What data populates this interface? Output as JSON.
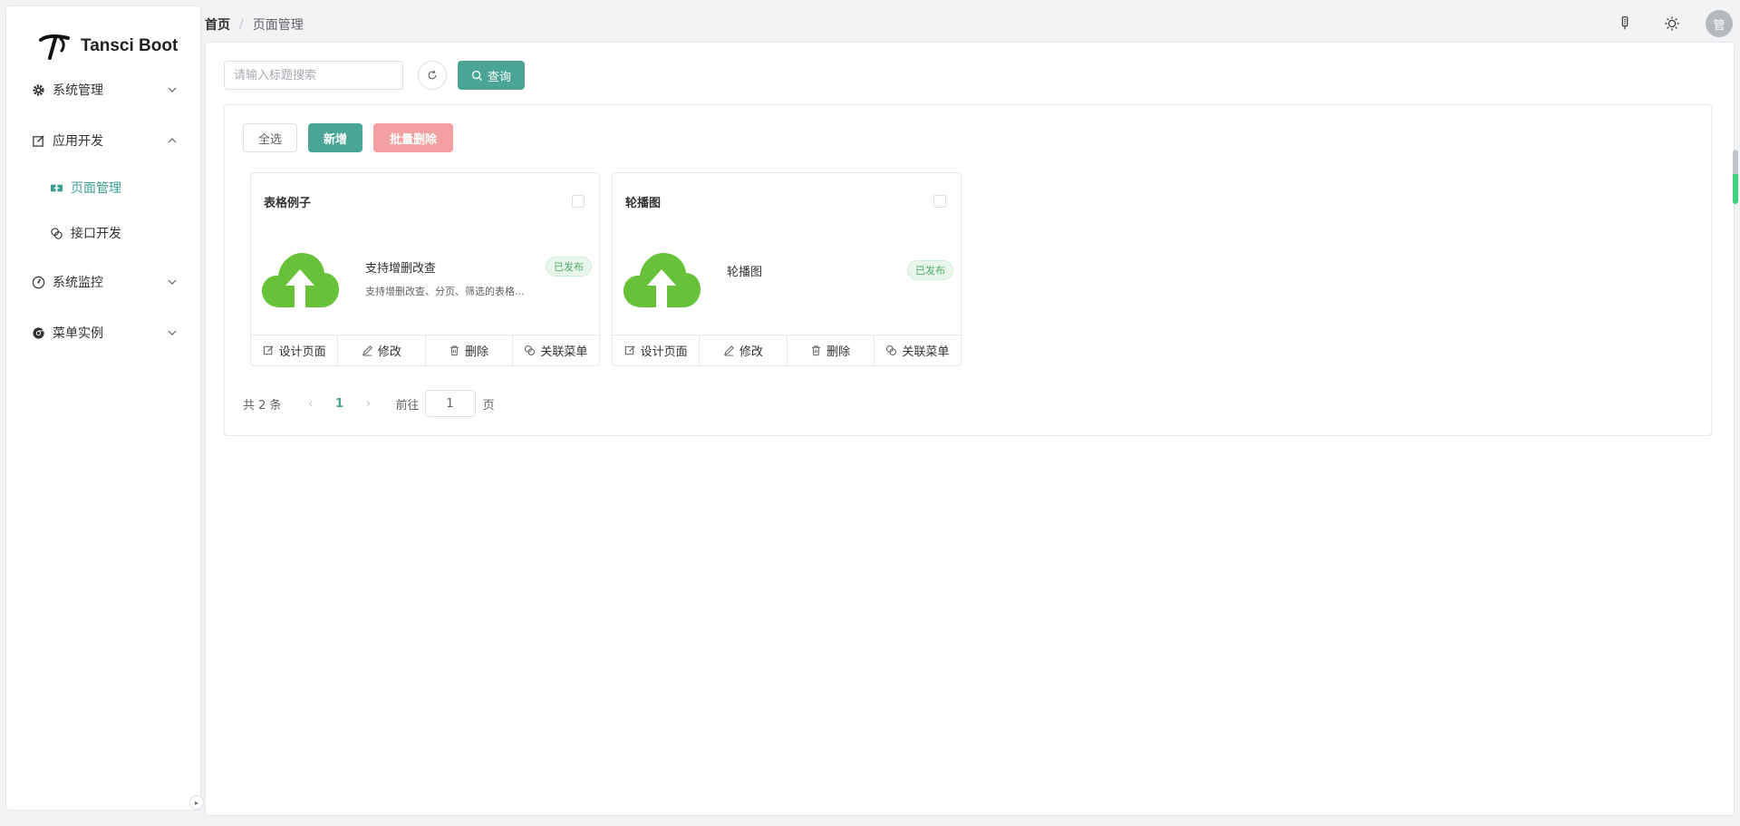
{
  "app": {
    "name": "Tansci Boot"
  },
  "sidebar": {
    "items": [
      {
        "label": "系统管理",
        "icon": "gear-icon",
        "expanded": false
      },
      {
        "label": "应用开发",
        "icon": "edit-icon",
        "expanded": true,
        "children": [
          {
            "label": "页面管理",
            "icon": "page-icon",
            "active": true
          },
          {
            "label": "接口开发",
            "icon": "link-icon",
            "active": false
          }
        ]
      },
      {
        "label": "系统监控",
        "icon": "gauge-icon",
        "expanded": false
      },
      {
        "label": "菜单实例",
        "icon": "chrome-icon",
        "expanded": false
      }
    ]
  },
  "breadcrumb": {
    "home": "首页",
    "separator": "/",
    "current": "页面管理"
  },
  "header": {
    "avatar_text": "管"
  },
  "search": {
    "placeholder": "请输入标题搜索",
    "value": "",
    "query_label": "查询"
  },
  "actions": {
    "select_all": "全选",
    "add": "新增",
    "batch_delete": "批量删除"
  },
  "cards": [
    {
      "title": "表格例子",
      "name": "支持增删改查",
      "desc": "支持增删改查、分页、筛选的表格...",
      "status": "已发布",
      "footer": {
        "design": "设计页面",
        "edit": "修改",
        "delete": "删除",
        "link_menu": "关联菜单"
      }
    },
    {
      "title": "轮播图",
      "name": "轮播图",
      "desc": "",
      "status": "已发布",
      "footer": {
        "design": "设计页面",
        "edit": "修改",
        "delete": "删除",
        "link_menu": "关联菜单"
      }
    }
  ],
  "pagination": {
    "total_text": "共 2 条",
    "current_page": "1",
    "goto_label": "前往",
    "goto_value": "1",
    "page_unit": "页"
  },
  "colors": {
    "primary": "#4aa596",
    "danger_light": "#f2a0a0",
    "success": "#4bab63",
    "upload_cloud": "#67c23a"
  }
}
